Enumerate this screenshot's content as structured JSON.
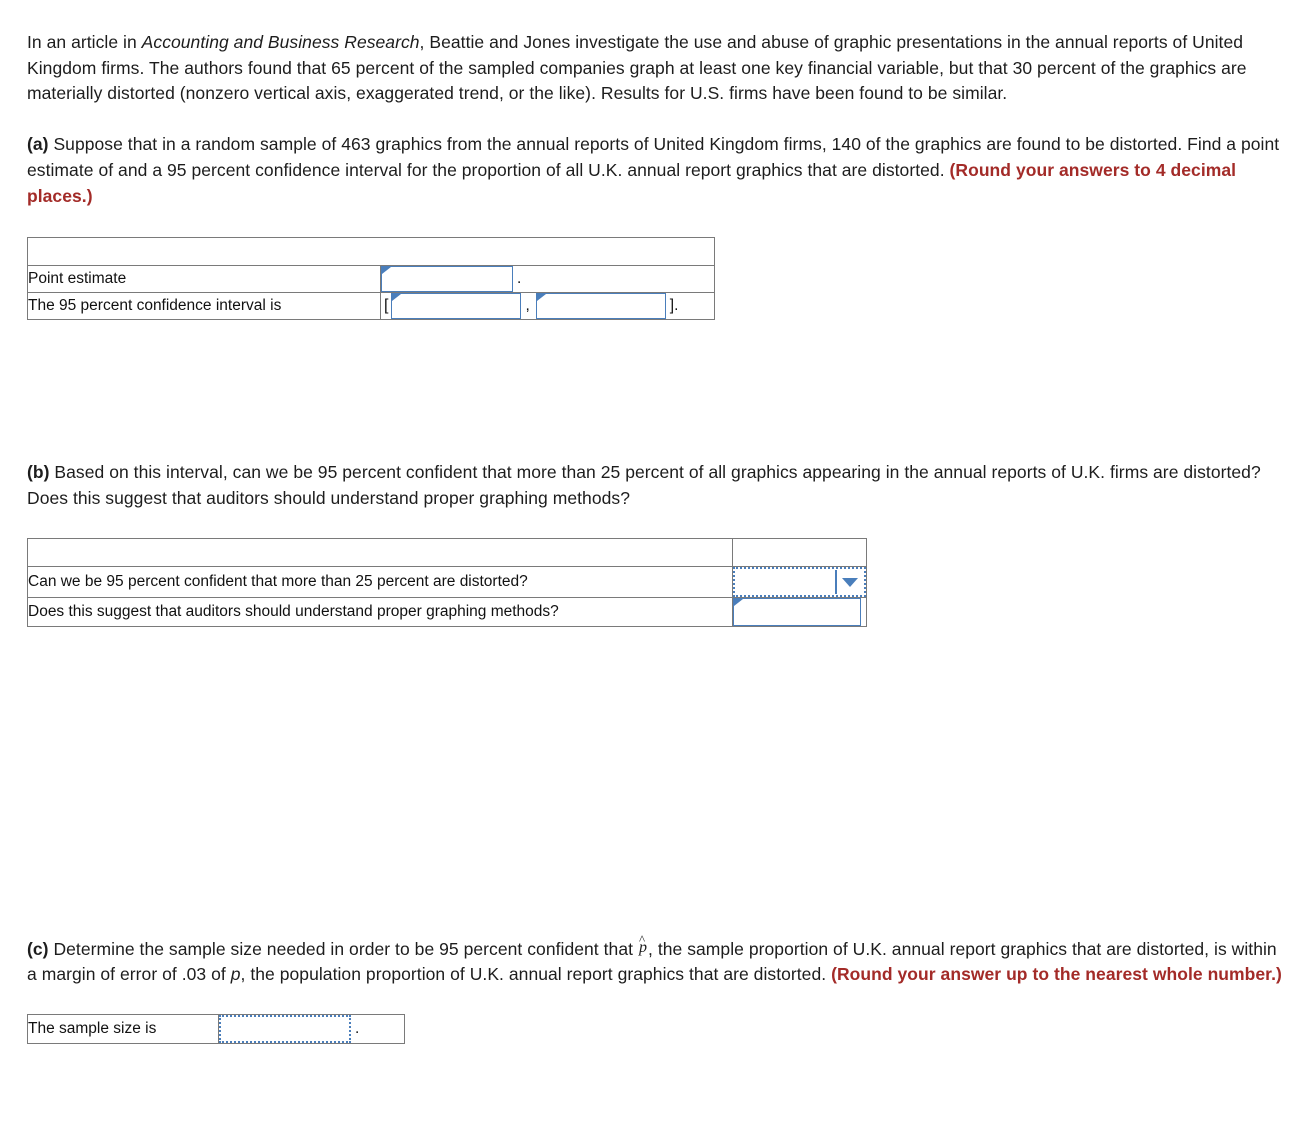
{
  "intro": {
    "segment_1": "In an article in ",
    "journal": "Accounting and Business Research",
    "segment_2": ", Beattie and Jones investigate the use and abuse of graphic presentations in the annual reports of United Kingdom firms. The authors found that 65 percent of the sampled companies graph at least one key financial variable, but that 30 percent of the graphics are materially distorted (nonzero vertical axis, exaggerated trend, or the like). Results for U.S. firms have been found to be similar."
  },
  "part_a": {
    "marker": "(a)",
    "text": " Suppose that in a random sample of 463 graphics from the annual reports of United Kingdom firms, 140 of the graphics are found to be distorted. Find a point estimate of and a 95 percent confidence interval for the proportion of all U.K. annual report graphics that are distorted. ",
    "rounding_note": "(Round your answers to 4 decimal places.)",
    "table": {
      "point_estimate_label": "Point estimate",
      "point_estimate_value": "",
      "point_estimate_suffix": ".",
      "ci_label": "The 95 percent confidence interval is",
      "ci_open_bracket": "[",
      "ci_lower_value": "",
      "ci_separator": ",",
      "ci_upper_value": "",
      "ci_close_bracket": "]."
    }
  },
  "part_b": {
    "marker": "(b)",
    "text": " Based on this interval, can we be 95 percent confident that more than 25 percent of all graphics appearing in the annual reports of U.K. firms are distorted? Does this suggest that auditors should understand proper graphing methods?",
    "table": {
      "question_1": "Can we be 95 percent confident that more than 25 percent are distorted?",
      "answer_1": "",
      "question_2": "Does this suggest that auditors should understand proper graphing methods?",
      "answer_2": ""
    }
  },
  "part_c": {
    "marker": "(c)",
    "text_1": " Determine the sample size needed in order to be 95 percent confident that ",
    "symbol": "p",
    "symbol_hat": "^",
    "text_2": ", the sample proportion of U.K. annual report graphics that are distorted, is within a margin of error of .03 of ",
    "symbol_p": "p",
    "text_3": ", the population proportion of U.K. annual report graphics that are distorted. ",
    "rounding_note": "(Round your answer up to the nearest whole number.)",
    "table": {
      "sample_size_label": "The sample size is",
      "sample_size_value": "",
      "sample_size_suffix": "."
    }
  },
  "colors": {
    "note_red": "#a32b28",
    "input_blue": "#4a7ebb",
    "header_fill": "#d8dce6",
    "table_border": "#7a7a7a"
  }
}
